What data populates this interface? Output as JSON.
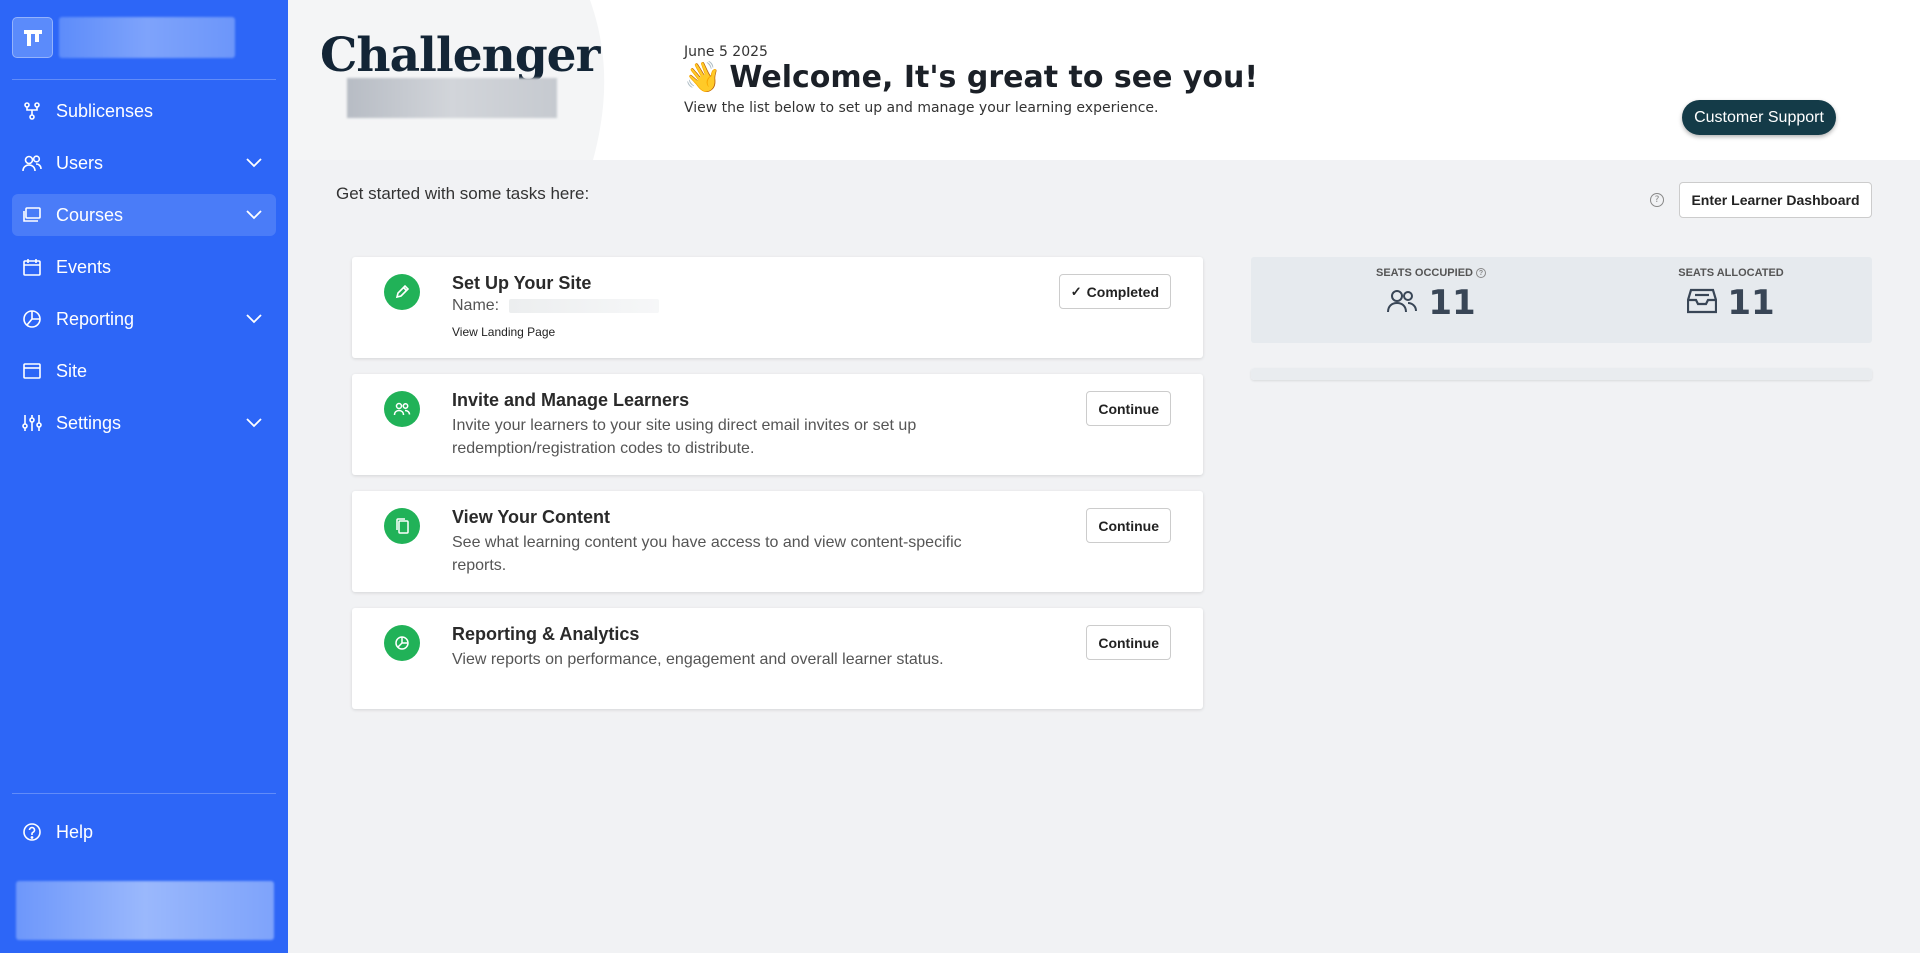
{
  "sidebar": {
    "items": [
      {
        "label": "Sublicenses",
        "icon": "sublicenses-icon",
        "has_dropdown": false
      },
      {
        "label": "Users",
        "icon": "users-icon",
        "has_dropdown": true
      },
      {
        "label": "Courses",
        "icon": "courses-icon",
        "has_dropdown": true,
        "active": true
      },
      {
        "label": "Events",
        "icon": "calendar-icon",
        "has_dropdown": false
      },
      {
        "label": "Reporting",
        "icon": "pie-chart-icon",
        "has_dropdown": true
      },
      {
        "label": "Site",
        "icon": "browser-window-icon",
        "has_dropdown": false
      },
      {
        "label": "Settings",
        "icon": "sliders-icon",
        "has_dropdown": true
      }
    ],
    "help_label": "Help"
  },
  "header": {
    "brand": "Challenger",
    "date": "June 5 2025",
    "welcome": "Welcome, It's great to see you!",
    "wave_emoji": "👋",
    "subtitle": "View the list below to set up and manage your learning experience.",
    "support_button": "Customer Support"
  },
  "main": {
    "tasks_heading": "Get started with some tasks here:",
    "learner_button": "Enter Learner Dashboard",
    "tasks": [
      {
        "title": "Set Up Your Site",
        "name_label": "Name:",
        "link": "View Landing Page",
        "button": "Completed",
        "icon": "pencil-icon"
      },
      {
        "title": "Invite and Manage Learners",
        "desc": "Invite your learners to your site using direct email invites or set up redemption/registration codes to distribute.",
        "button": "Continue",
        "icon": "users-icon"
      },
      {
        "title": "View Your Content",
        "desc": "See what learning content you have access to and view content-specific reports.",
        "button": "Continue",
        "icon": "copy-icon"
      },
      {
        "title": "Reporting & Analytics",
        "desc": "View reports on performance, engagement and overall learner status.",
        "button": "Continue",
        "icon": "pie-chart-icon"
      }
    ],
    "seats": {
      "occupied_label": "SEATS OCCUPIED",
      "occupied_value": "11",
      "allocated_label": "SEATS ALLOCATED",
      "allocated_value": "11"
    }
  },
  "colors": {
    "sidebar_bg": "#2d66f7",
    "accent_green": "#21b258",
    "support_button_bg": "#143b48"
  }
}
